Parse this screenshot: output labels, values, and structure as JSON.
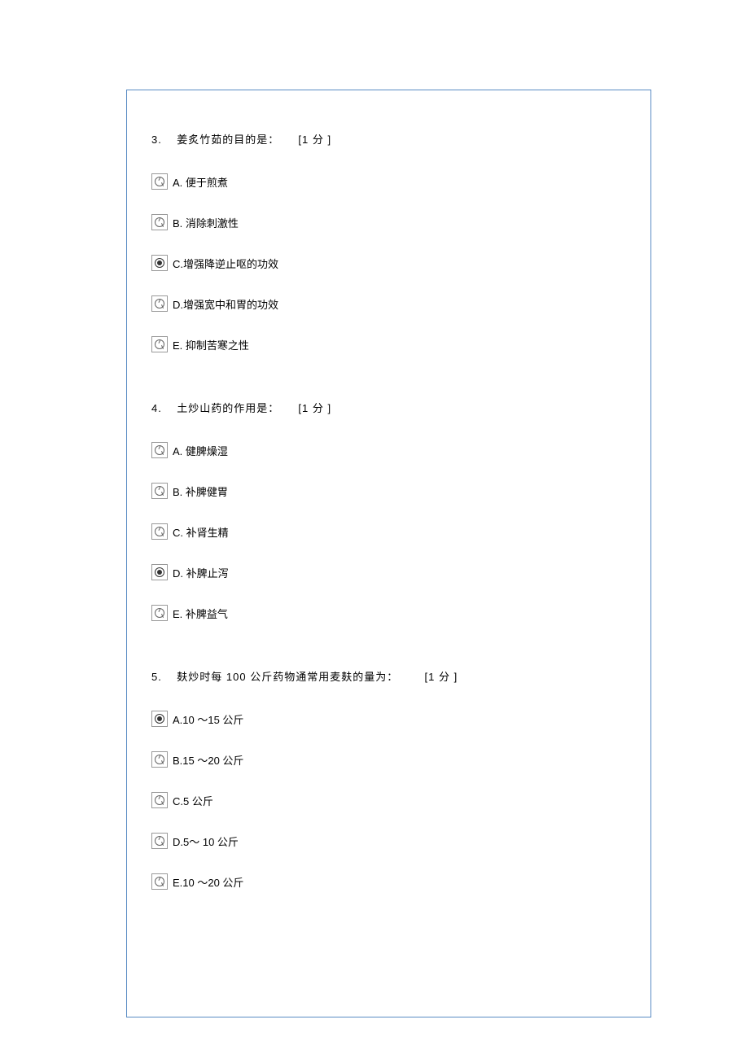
{
  "questions": [
    {
      "number": "3.",
      "stem": "姜炙竹茹的目的是：",
      "score": "[1   分 ]",
      "options": [
        {
          "label": "A. 便于煎煮",
          "selected": false
        },
        {
          "label": "B. 消除刺激性",
          "selected": false
        },
        {
          "label": "C.增强降逆止呕的功效",
          "selected": true
        },
        {
          "label": "D.增强宽中和胃的功效",
          "selected": false
        },
        {
          "label": "E. 抑制苦寒之性",
          "selected": false
        }
      ]
    },
    {
      "number": "4.",
      "stem": "土炒山药的作用是：",
      "score": "[1   分 ]",
      "options": [
        {
          "label": "A. 健脾燥湿",
          "selected": false
        },
        {
          "label": "B. 补脾健胃",
          "selected": false
        },
        {
          "label": "C. 补肾生精",
          "selected": false
        },
        {
          "label": "D. 补脾止泻",
          "selected": true
        },
        {
          "label": "E. 补脾益气",
          "selected": false
        }
      ]
    },
    {
      "number": "5.",
      "stem": "麸炒时每   100 公斤药物通常用麦麸的量为：",
      "score": "[1   分 ]",
      "options": [
        {
          "label": "A.10 ～15 公斤",
          "selected": true
        },
        {
          "label": "B.15 ～20 公斤",
          "selected": false
        },
        {
          "label": "C.5  公斤",
          "selected": false
        },
        {
          "label": "D.5～ 10 公斤",
          "selected": false
        },
        {
          "label": "E.10 ～20 公斤",
          "selected": false
        }
      ]
    }
  ]
}
